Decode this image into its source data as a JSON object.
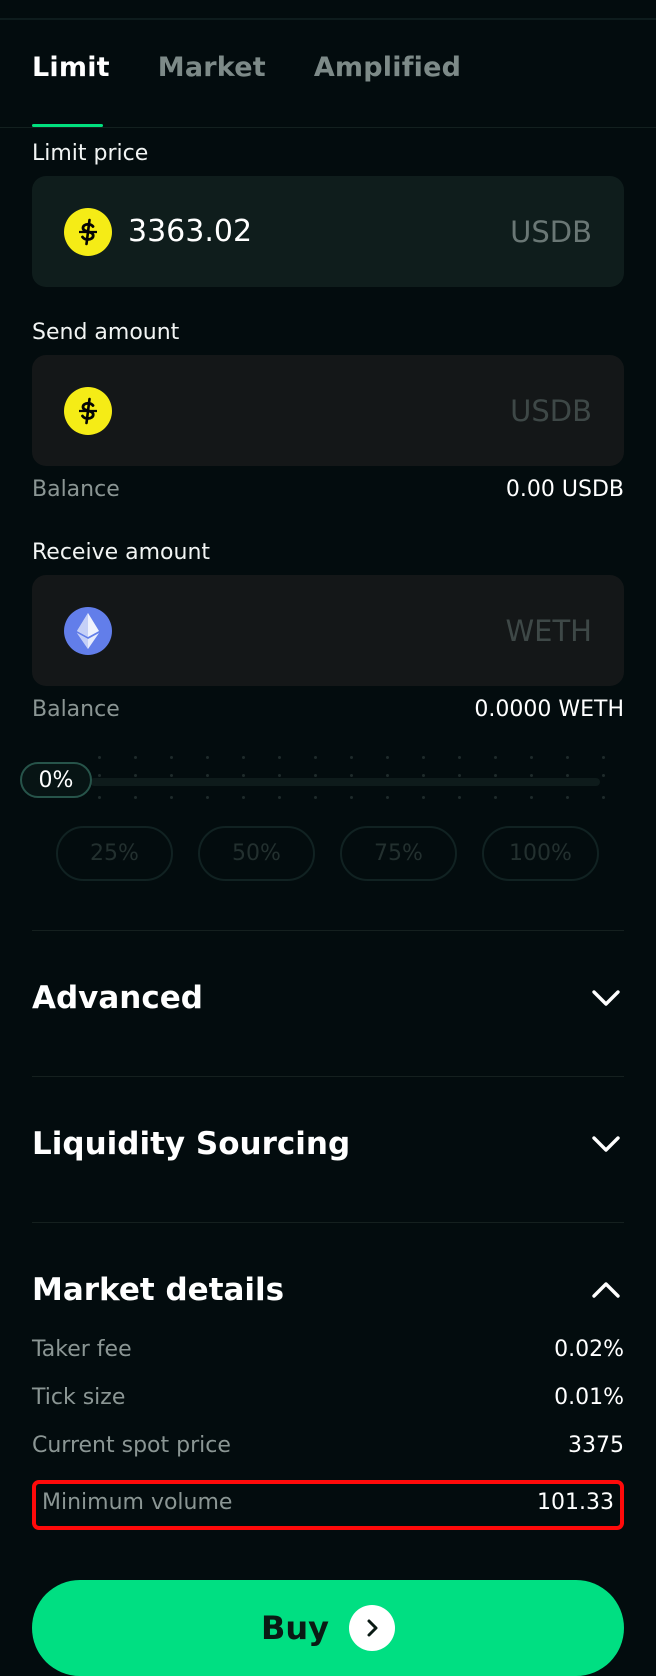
{
  "tabs": [
    {
      "label": "Limit",
      "active": true
    },
    {
      "label": "Market",
      "active": false
    },
    {
      "label": "Amplified",
      "active": false
    }
  ],
  "limit_price": {
    "label": "Limit price",
    "value": "3363.02",
    "unit": "USDB",
    "icon": "usdb-coin-icon"
  },
  "send_amount": {
    "label": "Send amount",
    "value": "",
    "unit": "USDB",
    "icon": "usdb-coin-icon",
    "balance_label": "Balance",
    "balance_value": "0.00 USDB"
  },
  "receive_amount": {
    "label": "Receive amount",
    "value": "",
    "unit": "WETH",
    "icon": "eth-coin-icon",
    "balance_label": "Balance",
    "balance_value": "0.0000 WETH"
  },
  "slider": {
    "value_label": "0%",
    "value_fraction": 0,
    "quick_options": [
      "25%",
      "50%",
      "75%",
      "100%"
    ]
  },
  "sections": {
    "advanced": {
      "title": "Advanced",
      "expanded": false
    },
    "liquidity": {
      "title": "Liquidity Sourcing",
      "expanded": false
    },
    "market_details": {
      "title": "Market details",
      "expanded": true
    }
  },
  "market_details": {
    "taker_fee": {
      "label": "Taker fee",
      "value": "0.02%"
    },
    "tick_size": {
      "label": "Tick size",
      "value": "0.01%"
    },
    "spot_price": {
      "label": "Current spot price",
      "value": "3375"
    },
    "min_volume": {
      "label": "Minimum volume",
      "value": "101.33"
    }
  },
  "buy_button": {
    "label": "Buy"
  },
  "colors": {
    "background": "#030c0e",
    "accent": "#00df82",
    "usdb": "#f5ec16",
    "eth": "#627eea",
    "highlight": "#ff0a0a"
  }
}
